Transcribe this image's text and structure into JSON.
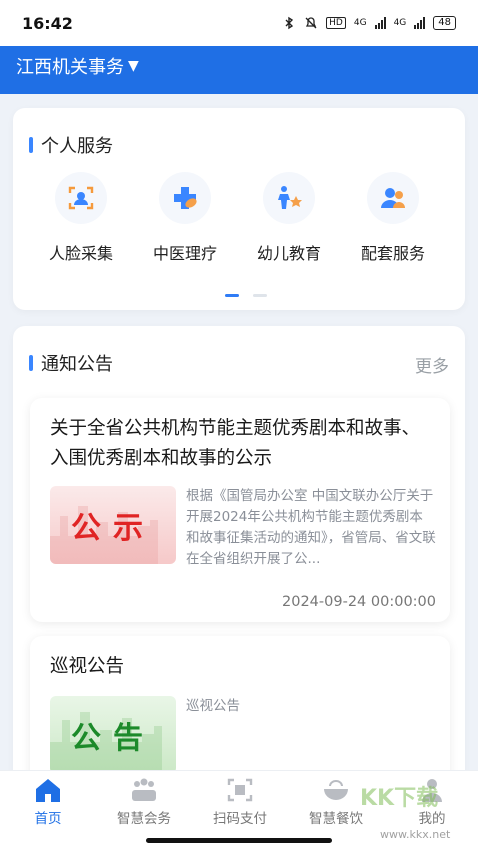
{
  "status_bar": {
    "time": "16:42",
    "network_hd": "HD",
    "network_a": "4G",
    "network_b": "4G",
    "battery": "48"
  },
  "header": {
    "title": "江西机关事务",
    "caret": "▼",
    "background_color": "#1f6fe5"
  },
  "personal_services": {
    "heading": "个人服务",
    "items": [
      {
        "label": "人脸采集",
        "icon": "face-scan-icon"
      },
      {
        "label": "中医理疗",
        "icon": "tcm-medicine-icon"
      },
      {
        "label": "幼儿教育",
        "icon": "child-education-icon"
      },
      {
        "label": "配套服务",
        "icon": "support-service-icon"
      }
    ],
    "pager": {
      "pages": 2,
      "active": 1
    }
  },
  "notices": {
    "heading": "通知公告",
    "more_label": "更多",
    "items": [
      {
        "title": "关于全省公共机构节能主题优秀剧本和故事、入围优秀剧本和故事的公示",
        "thumb_text": "公示",
        "excerpt": "根据《国管局办公室 中国文联办公厅关于开展2024年公共机构节能主题优秀剧本和故事征集活动的通知》，省管局、省文联在全省组织开展了公...",
        "date": "2024-09-24 00:00:00"
      },
      {
        "title": "巡视公告",
        "thumb_text": "公告",
        "excerpt": "巡视公告"
      }
    ]
  },
  "tabbar": {
    "tabs": [
      {
        "label": "首页",
        "icon": "home-icon",
        "active": true
      },
      {
        "label": "智慧会务",
        "icon": "meeting-people-icon",
        "active": false
      },
      {
        "label": "扫码支付",
        "icon": "scan-code-icon",
        "active": false
      },
      {
        "label": "智慧餐饮",
        "icon": "dining-bowl-icon",
        "active": false
      },
      {
        "label": "我的",
        "icon": "user-profile-icon",
        "active": false
      }
    ]
  },
  "watermark": {
    "text": "KK下载",
    "url": "www.kkx.net"
  }
}
